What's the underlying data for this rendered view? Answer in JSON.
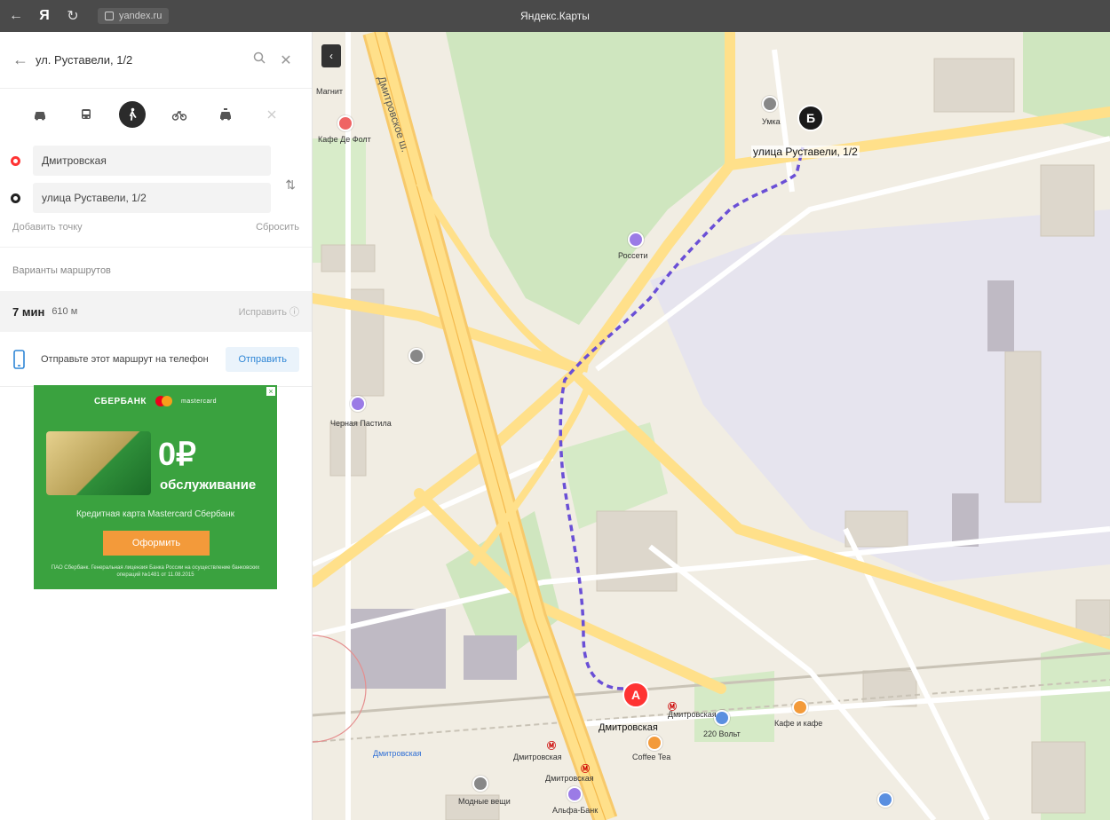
{
  "browser": {
    "back": "←",
    "yandex_logo": "Я",
    "reload": "↻",
    "url": "yandex.ru",
    "tab_title": "Яндекс.Карты"
  },
  "search": {
    "query": "ул. Руставели, 1/2",
    "search_icon": "search-icon",
    "close": "✕"
  },
  "modes": [
    "car",
    "bus",
    "walk",
    "bike",
    "taxi",
    "more"
  ],
  "route": {
    "from": "Дмитровская",
    "to": "улица Руставели, 1/2",
    "add_point": "Добавить точку",
    "reset": "Сбросить",
    "variants_title": "Варианты маршрутов",
    "time": "7 мин",
    "distance": "610 м",
    "fix": "Исправить ⓘ"
  },
  "send": {
    "text": "Отправьте этот маршрут на телефон",
    "button": "Отправить"
  },
  "ad": {
    "close": "×",
    "brand1": "СБЕРБАНК",
    "brand2": "mastercard",
    "price": "0₽",
    "price_sub": "обслуживание",
    "desc": "Кредитная карта Mastercard Сбербанк",
    "button": "Оформить",
    "legal": "ПАО Сбербанк. Генеральная лицензия Банка России на осуществление банковских операций №1481 от 11.08.2015"
  },
  "map": {
    "collapse": "‹",
    "street_main": "Дмитровское ш.",
    "dest_label": "улица Руставели, 1/2",
    "start_label": "Дмитровская",
    "metro_labels": [
      "Дмитровская",
      "Дмитровская",
      "Дмитровская"
    ],
    "poi_labels": [
      "Магнит",
      "Кафе Де Фолт",
      "Россети",
      "Черная Пастила",
      "Умка",
      "220 Вольт",
      "Кафе и кафе",
      "Coffee Tea",
      "Модные вещи",
      "Альфа-Банк",
      "Дмитровская"
    ],
    "colors": {
      "route": "#6a4fd6",
      "park": "#cfe6bf",
      "road": "#ffe08a",
      "highway": "#f7c96b",
      "water": "#bfdbf0"
    }
  }
}
